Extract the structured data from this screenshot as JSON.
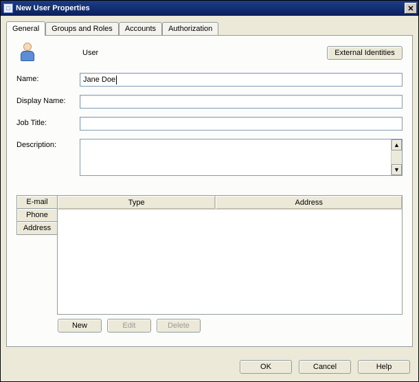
{
  "window": {
    "title": "New User Properties"
  },
  "tabs": [
    "General",
    "Groups and Roles",
    "Accounts",
    "Authorization"
  ],
  "header": {
    "type_label": "User",
    "ext_id_btn": "External Identities"
  },
  "form": {
    "name_label": "Name:",
    "name_value": "Jane Doe",
    "display_label": "Display Name:",
    "display_value": "",
    "job_label": "Job Title:",
    "job_value": "",
    "desc_label": "Description:",
    "desc_value": ""
  },
  "side_tabs": [
    "E-mail",
    "Phone",
    "Address"
  ],
  "columns": {
    "type": "Type",
    "address": "Address"
  },
  "list_buttons": {
    "new": "New",
    "edit": "Edit",
    "delete": "Delete"
  },
  "footer": {
    "ok": "OK",
    "cancel": "Cancel",
    "help": "Help"
  }
}
